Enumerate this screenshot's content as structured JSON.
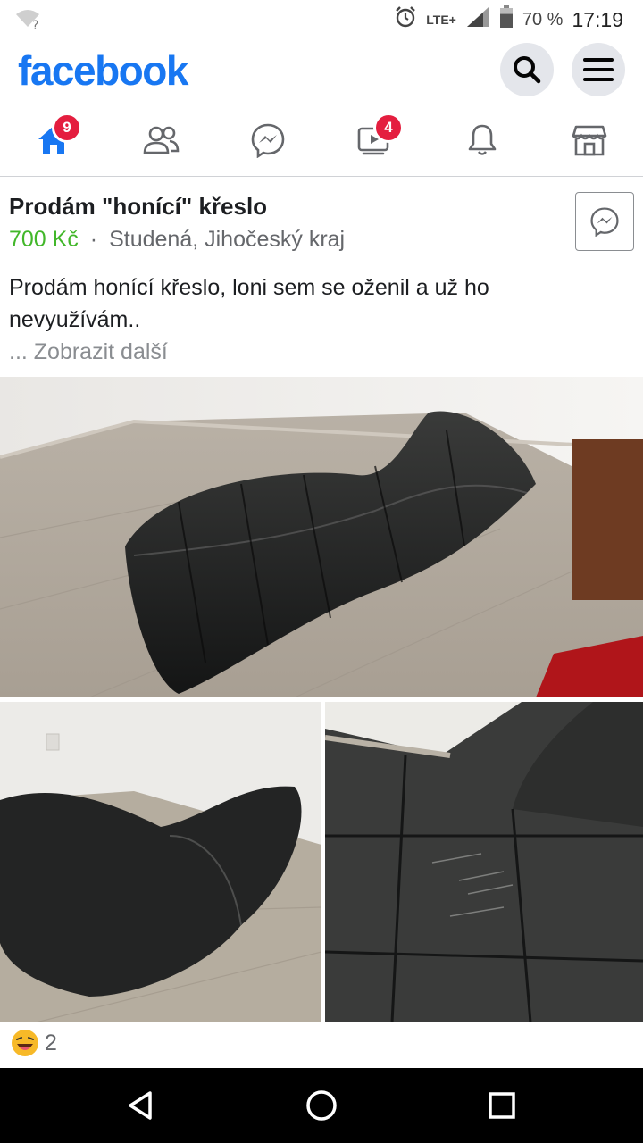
{
  "status_bar": {
    "wifi_icon": "wifi-unknown-icon",
    "network": "LTE+",
    "battery_percent": "70 %",
    "battery_level": 0.7,
    "time": "17:19"
  },
  "header": {
    "logo": "facebook",
    "search_icon": "search-icon",
    "menu_icon": "hamburger-menu-icon"
  },
  "tabs": [
    {
      "name": "home",
      "icon": "home-icon",
      "badge": "9",
      "active": true
    },
    {
      "name": "friends",
      "icon": "friends-icon",
      "badge": null
    },
    {
      "name": "messenger",
      "icon": "messenger-icon",
      "badge": null
    },
    {
      "name": "watch",
      "icon": "video-icon",
      "badge": "4"
    },
    {
      "name": "notifications",
      "icon": "bell-icon",
      "badge": null
    },
    {
      "name": "marketplace",
      "icon": "store-icon",
      "badge": null
    }
  ],
  "post": {
    "title": "Prodám \"honící\" křeslo",
    "price": "700 Kč",
    "separator": "·",
    "location": "Studená, Jihočeský kraj",
    "description": "Prodám honící křeslo, loni sem se oženil a už ho nevyužívám..",
    "see_more": "... Zobrazit další",
    "reactions": {
      "icon": "laughing-emoji-icon",
      "count": "2"
    }
  },
  "colors": {
    "brand": "#1877f2",
    "price": "#42b72a",
    "badge": "#e41e3f"
  }
}
